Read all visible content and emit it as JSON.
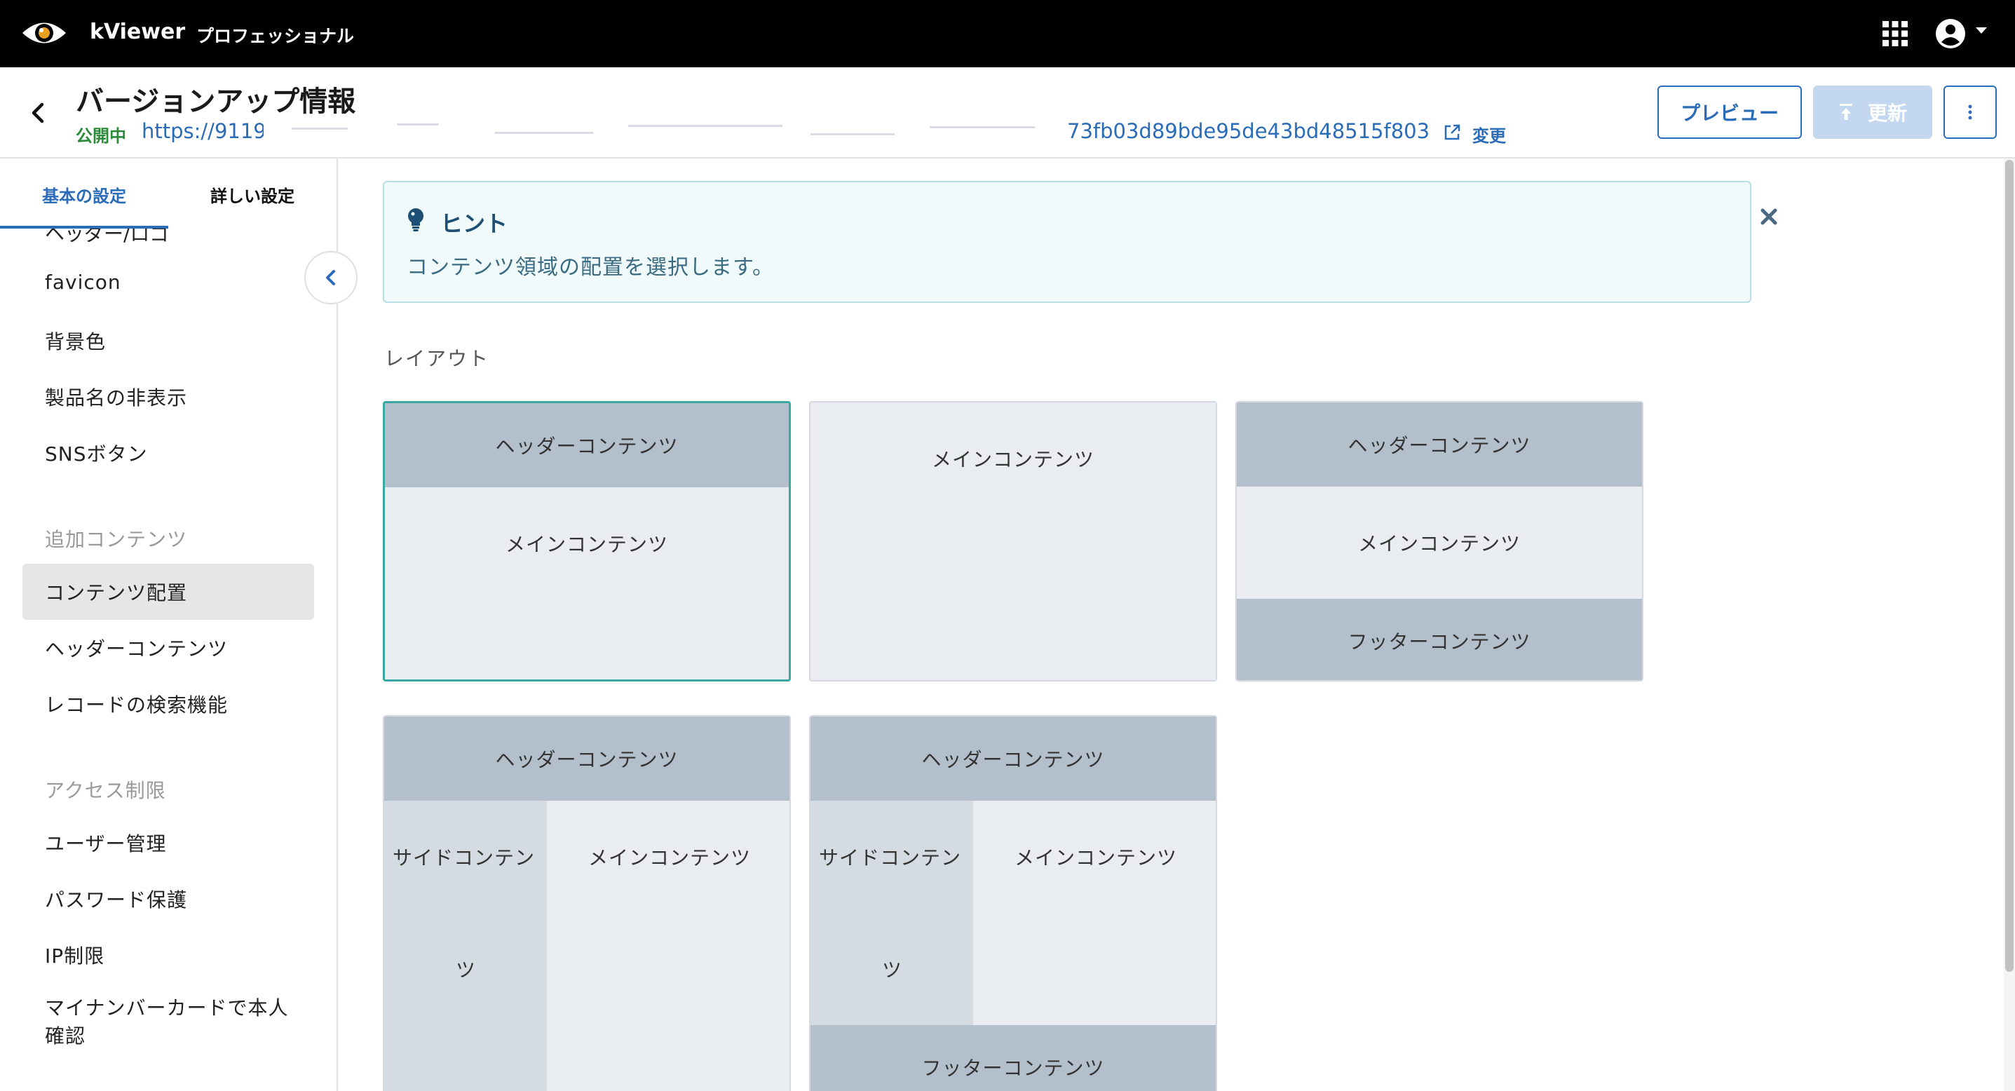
{
  "topbar": {
    "app_name": "kViewer",
    "edition": "プロフェッショナル",
    "logo_icon": "eye-logo",
    "apps_icon": "grid-apps-icon",
    "account_icon": "account-circle-icon"
  },
  "header": {
    "title": "バージョンアップ情報",
    "status": "公開中",
    "url_start": "https://9119",
    "url_end": "73fb03d89bde95de43bd48515f803",
    "change_label": "変更",
    "preview_label": "プレビュー",
    "update_label": "更新",
    "colors": {
      "link": "#2b6cb8",
      "status": "#2a8a3a"
    }
  },
  "sidebar": {
    "tabs": [
      {
        "label": "基本の設定",
        "active": true
      },
      {
        "label": "詳しい設定",
        "active": false
      }
    ],
    "cut_item": "ヘッダー/ロゴ",
    "items_group1": [
      "favicon",
      "背景色",
      "製品名の非表示",
      "SNSボタン"
    ],
    "heading_additional": "追加コンテンツ",
    "items_group2": [
      "コンテンツ配置",
      "ヘッダーコンテンツ",
      "レコードの検索機能"
    ],
    "selected_item": "コンテンツ配置",
    "heading_access": "アクセス制限",
    "items_group3": [
      "ユーザー管理",
      "パスワード保護",
      "IP制限",
      "マイナンバーカードで本人確認"
    ]
  },
  "main": {
    "hint_title": "ヒント",
    "hint_text": "コンテンツ領域の配置を選択します。",
    "layout_label": "レイアウト",
    "regions": {
      "header": "ヘッダーコンテンツ",
      "main": "メインコンテンツ",
      "footer": "フッターコンテンツ",
      "side_top": "サイドコンテン",
      "side_bottom": "ツ"
    },
    "colors": {
      "selected_border": "#3aa8a2",
      "region_dark": "#b4bfcc",
      "region_light": "#e9ecf0"
    }
  }
}
